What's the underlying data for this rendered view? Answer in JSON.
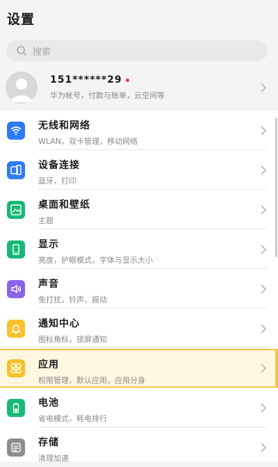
{
  "header": {
    "title": "设置"
  },
  "search": {
    "placeholder": "搜索"
  },
  "account": {
    "name": "151******29",
    "subtitle": "华为帐号，付款与账单，云空间等"
  },
  "items": [
    {
      "label": "无线和网络",
      "sub": "WLAN，双卡管理，移动网络",
      "icon": "wifi-icon",
      "color": "#2f7bf5"
    },
    {
      "label": "设备连接",
      "sub": "蓝牙，打印",
      "icon": "device-connection-icon",
      "color": "#2f7bf5"
    },
    {
      "label": "桌面和壁纸",
      "sub": "主题",
      "icon": "wallpaper-icon",
      "color": "#17b978"
    },
    {
      "label": "显示",
      "sub": "亮度，护眼模式，字体与显示大小",
      "icon": "display-icon",
      "color": "#17b978"
    },
    {
      "label": "声音",
      "sub": "免打扰，铃声，振动",
      "icon": "sound-icon",
      "color": "#8a63e8"
    },
    {
      "label": "通知中心",
      "sub": "图标角标，锁屏通知",
      "icon": "notification-icon",
      "color": "#f6c12a"
    },
    {
      "label": "应用",
      "sub": "权限管理，默认应用，应用分身",
      "icon": "apps-icon",
      "color": "#f6c12a"
    },
    {
      "label": "电池",
      "sub": "省电模式，耗电排行",
      "icon": "battery-icon",
      "color": "#17b978"
    },
    {
      "label": "存储",
      "sub": "清理加速",
      "icon": "storage-icon",
      "color": "#8c8c8c"
    }
  ]
}
